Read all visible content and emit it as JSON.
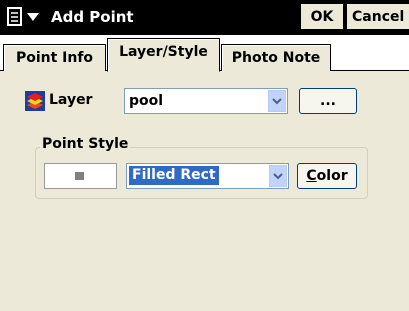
{
  "window": {
    "title": "Add Point",
    "ok_label": "OK",
    "cancel_label": "Cancel"
  },
  "tabs": [
    {
      "label": "Point Info",
      "active": false
    },
    {
      "label": "Layer/Style",
      "active": true
    },
    {
      "label": "Photo Note",
      "active": false
    }
  ],
  "layer": {
    "label": "Layer",
    "value": "pool",
    "browse_label": "..."
  },
  "point_style": {
    "legend": "Point Style",
    "value": "Filled Rect",
    "color_hotkey": "C",
    "color_rest": "olor"
  },
  "colors": {
    "accent": "#316ac5",
    "dialog_bg": "#ece9d8",
    "swatch": "#808080"
  }
}
